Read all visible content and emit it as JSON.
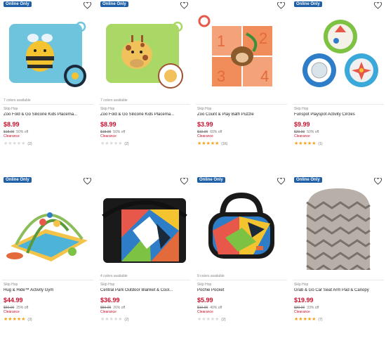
{
  "badge_label": "Online Only",
  "icons": {
    "favorite": "heart-outline-icon",
    "star": "star-icon"
  },
  "colors": {
    "badge": "#1d5fa8",
    "sale_price": "#c8102e",
    "star_filled": "#f2a31b",
    "star_empty": "#d8d8d8"
  },
  "products": [
    {
      "badge": "Online Only",
      "variants": "7 colors available",
      "brand": "Skip Hop",
      "name": "Zoo Fold & Go Silicone Kids Placema...",
      "price": "$8.99",
      "original_price": "$18.00",
      "discount": "50% off",
      "clearance": "Clearance",
      "rating": 0,
      "reviews": "(2)",
      "image": "bee-placemat"
    },
    {
      "badge": "Online Only",
      "variants": "7 colors available",
      "brand": "Skip Hop",
      "name": "Zoo Fold & Go Silicone Kids Placema...",
      "price": "$8.99",
      "original_price": "$18.00",
      "discount": "50% off",
      "clearance": "Clearance",
      "rating": 0,
      "reviews": "(2)",
      "image": "giraffe-placemat"
    },
    {
      "badge": "",
      "variants": "",
      "brand": "Skip Hop",
      "name": "Zoo Count & Play Bath Puzzle",
      "price": "$3.99",
      "original_price": "$10.00",
      "discount": "60% off",
      "clearance": "Clearance",
      "rating": 5,
      "reviews": "(16)",
      "image": "bath-puzzle"
    },
    {
      "badge": "Online Only",
      "variants": "",
      "brand": "Skip Hop",
      "name": "Funspot Playspot Activity Circles",
      "price": "$9.99",
      "original_price": "$20.00",
      "discount": "50% off",
      "clearance": "Clearance",
      "rating": 5,
      "reviews": "(1)",
      "image": "activity-circles"
    },
    {
      "badge": "Online Only",
      "variants": "",
      "brand": "Skip Hop",
      "name": "Hug & Hide™ Activity Gym",
      "price": "$44.99",
      "original_price": "$60.00",
      "discount": "25% off",
      "clearance": "Clearance",
      "rating": 5,
      "reviews": "(3)",
      "image": "activity-gym"
    },
    {
      "badge": "",
      "variants": "4 colors available",
      "brand": "Skip Hop",
      "name": "Central Park Outdoor Blanket & Cool...",
      "price": "$36.99",
      "original_price": "$50.00",
      "discount": "26% off",
      "clearance": "Clearance",
      "rating": 0,
      "reviews": "(2)",
      "image": "outdoor-blanket"
    },
    {
      "badge": "Online Only",
      "variants": "9 colors available",
      "brand": "Skip Hop",
      "name": "Pochie Pocket",
      "price": "$5.99",
      "original_price": "$10.00",
      "discount": "40% off",
      "clearance": "Clearance",
      "rating": 0,
      "reviews": "(2)",
      "image": "pochie-pocket"
    },
    {
      "badge": "Online Only",
      "variants": "",
      "brand": "Skip Hop",
      "name": "Grab & Go Car Seat Arm Pad & Canopy",
      "price": "$19.99",
      "original_price": "$30.00",
      "discount": "33% off",
      "clearance": "Clearance",
      "rating": 5,
      "reviews": "(7)",
      "image": "car-seat-canopy"
    }
  ]
}
